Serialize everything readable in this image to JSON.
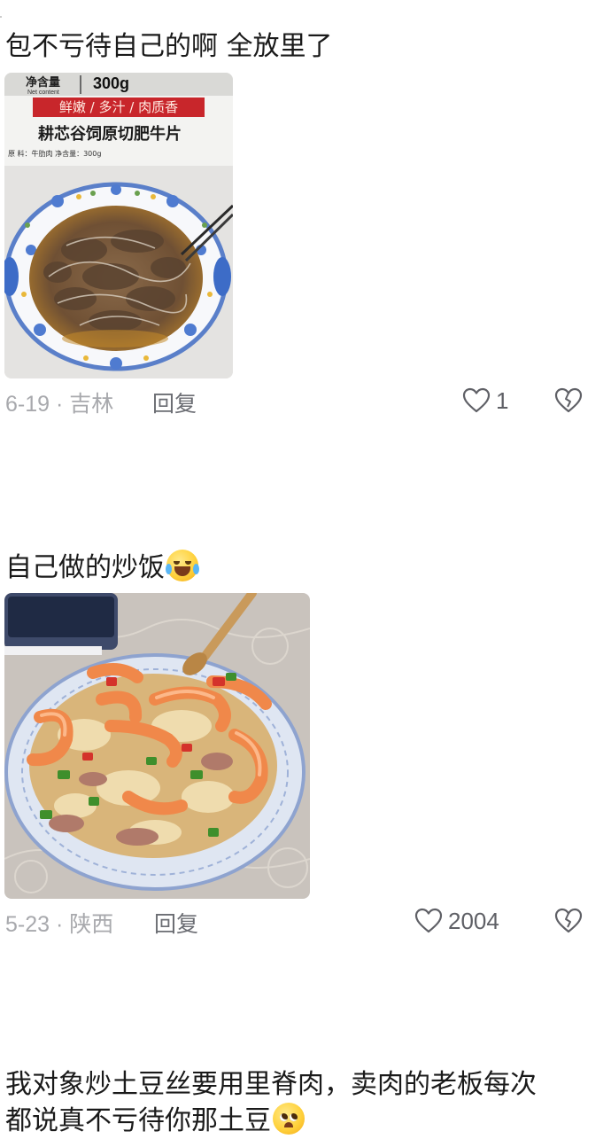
{
  "comments": [
    {
      "text": "包不亏待自己的啊 全放里了",
      "date_location": "6-19 · 吉林",
      "reply_label": "回复",
      "like_count": "1",
      "photo": {
        "package_net_label": "净含量",
        "package_net_en": "Net content",
        "package_weight": "300g",
        "package_tagline": "鲜嫩 / 多汁 / 肉质香",
        "package_product": "耕芯谷饲原切肥牛片",
        "package_fine_print": "原  料：牛肋肉  净含量：300g"
      }
    },
    {
      "text": "自己做的炒饭",
      "emoji": "crying-laughing-emoji",
      "date_location": "5-23 · 陕西",
      "reply_label": "回复",
      "like_count": "2004"
    },
    {
      "text_line1": "我对象炒土豆丝要用里脊肉，卖肉的老板每次",
      "text_line2": "都说真不亏待你那土豆",
      "emoji": "pleading-face-emoji"
    }
  ],
  "colors": {
    "text": "#1a1a1a",
    "meta": "#a8a9ad",
    "reply": "#6b6d73",
    "package_red": "#c8262b"
  }
}
